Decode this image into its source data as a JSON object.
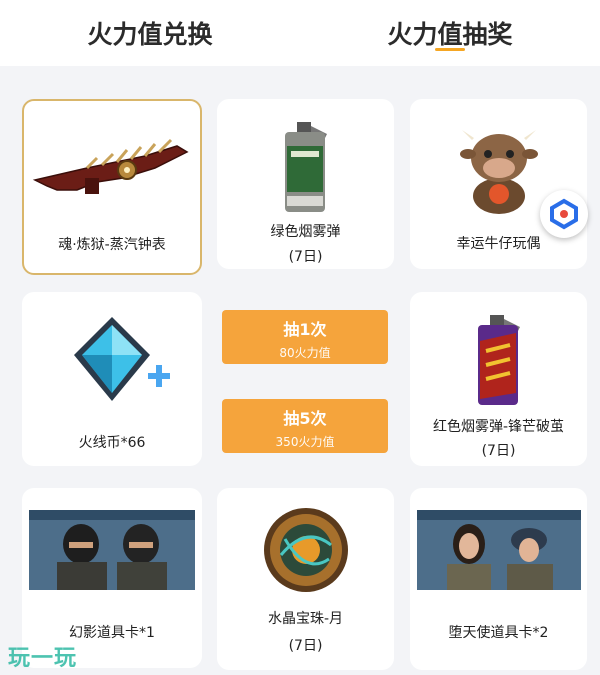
{
  "tabs": [
    {
      "label": "火力值兑换",
      "active": false
    },
    {
      "label": "火力值抽奖",
      "active": true
    }
  ],
  "items": [
    {
      "name": "魂·炼狱-蒸汽钟表",
      "sub": "",
      "icon": "rifle-icon",
      "selected": true
    },
    {
      "name": "绿色烟雾弹",
      "sub": "(7日)",
      "icon": "green-smoke-grenade-icon"
    },
    {
      "name": "幸运牛仔玩偶",
      "sub": "",
      "icon": "cow-doll-icon"
    },
    {
      "name": "火线币*66",
      "sub": "",
      "icon": "blue-diamond-icon"
    },
    {
      "name": "红色烟雾弹-锋芒破茧",
      "sub": "(7日)",
      "icon": "red-smoke-grenade-icon"
    },
    {
      "name": "幻影道具卡*1",
      "sub": "",
      "icon": "soldier-card-icon"
    },
    {
      "name": "水晶宝珠-月",
      "sub": "(7日)",
      "icon": "crystal-orb-icon"
    },
    {
      "name": "堕天使道具卡*2",
      "sub": "",
      "icon": "female-soldier-card-icon"
    }
  ],
  "draw_buttons": [
    {
      "label": "抽1次",
      "cost": "80火力值"
    },
    {
      "label": "抽5次",
      "cost": "350火力值"
    }
  ],
  "watermark": "玩一玩",
  "colors": {
    "accent": "#f5a43c",
    "selected_border": "#d9b66b",
    "watermark": "#2fb9a3"
  }
}
